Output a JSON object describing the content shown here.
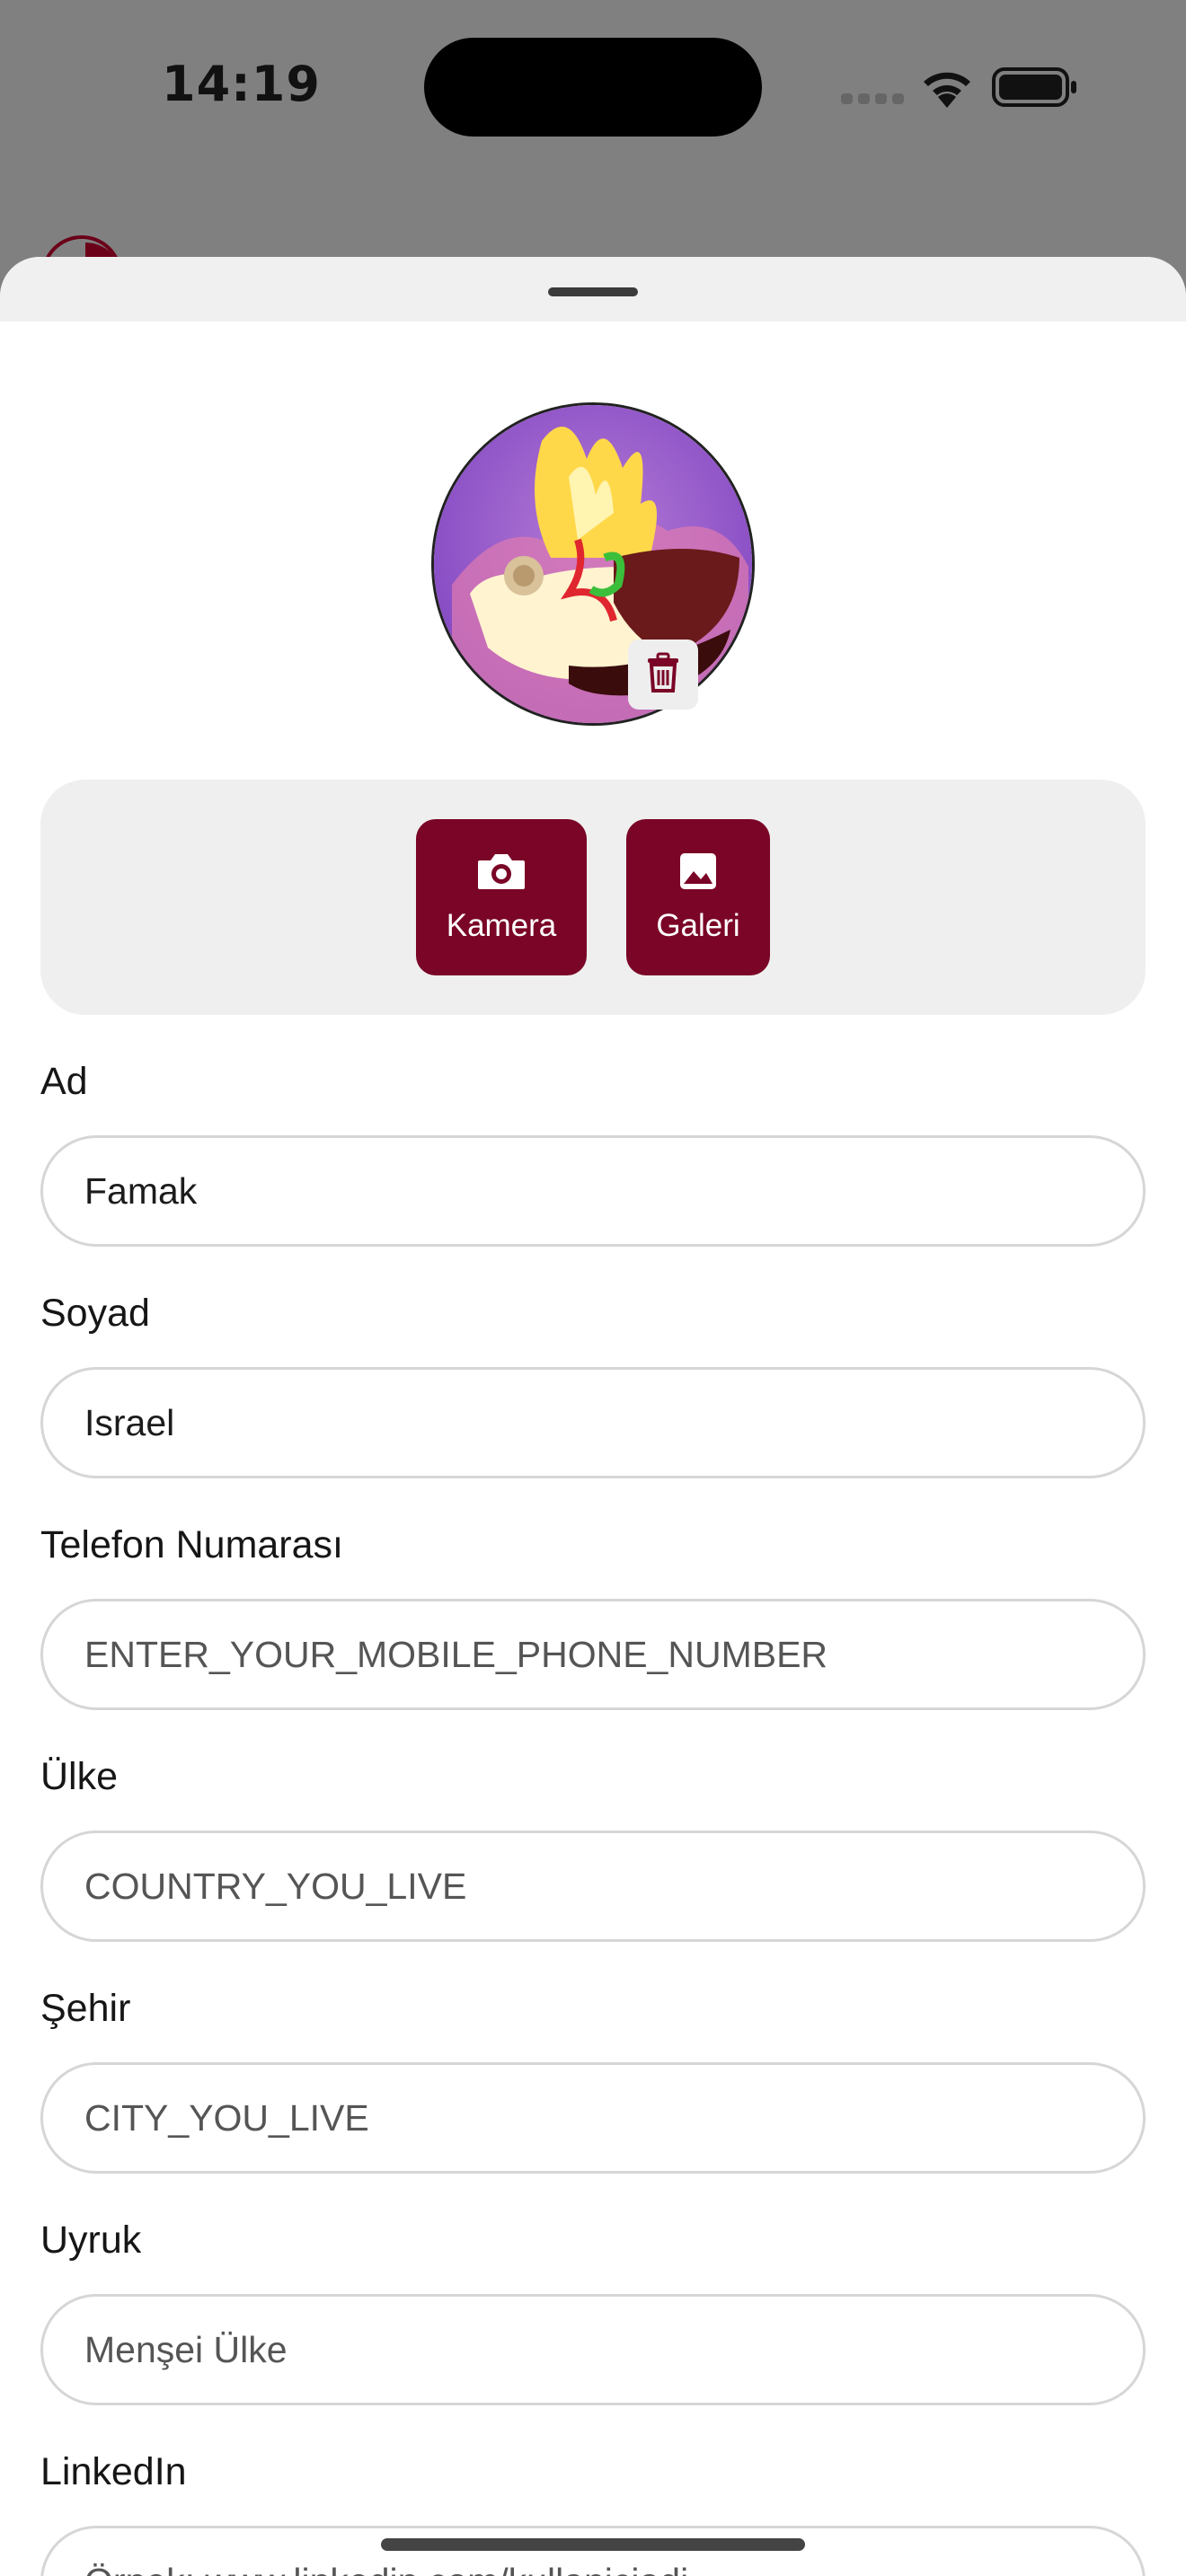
{
  "status_bar": {
    "time": "14:19"
  },
  "profile": {
    "photo_actions": {
      "camera_label": "Kamera",
      "gallery_label": "Galeri"
    },
    "fields": {
      "first_name": {
        "label": "Ad",
        "value": "Famak"
      },
      "last_name": {
        "label": "Soyad",
        "value": "Israel"
      },
      "phone": {
        "label": "Telefon Numarası",
        "value": "ENTER_YOUR_MOBILE_PHONE_NUMBER"
      },
      "country": {
        "label": "Ülke",
        "value": "COUNTRY_YOU_LIVE"
      },
      "city": {
        "label": "Şehir",
        "value": "CITY_YOU_LIVE"
      },
      "nationality": {
        "label": "Uyruk",
        "placeholder": "Menşei Ülke"
      },
      "linkedin": {
        "label": "LinkedIn",
        "placeholder": "Örnek: www.linkedin.com/kullaniciadi"
      }
    }
  },
  "colors": {
    "accent": "#7a0526",
    "sheet_header": "#f0f0f0",
    "backdrop": "#808080"
  }
}
